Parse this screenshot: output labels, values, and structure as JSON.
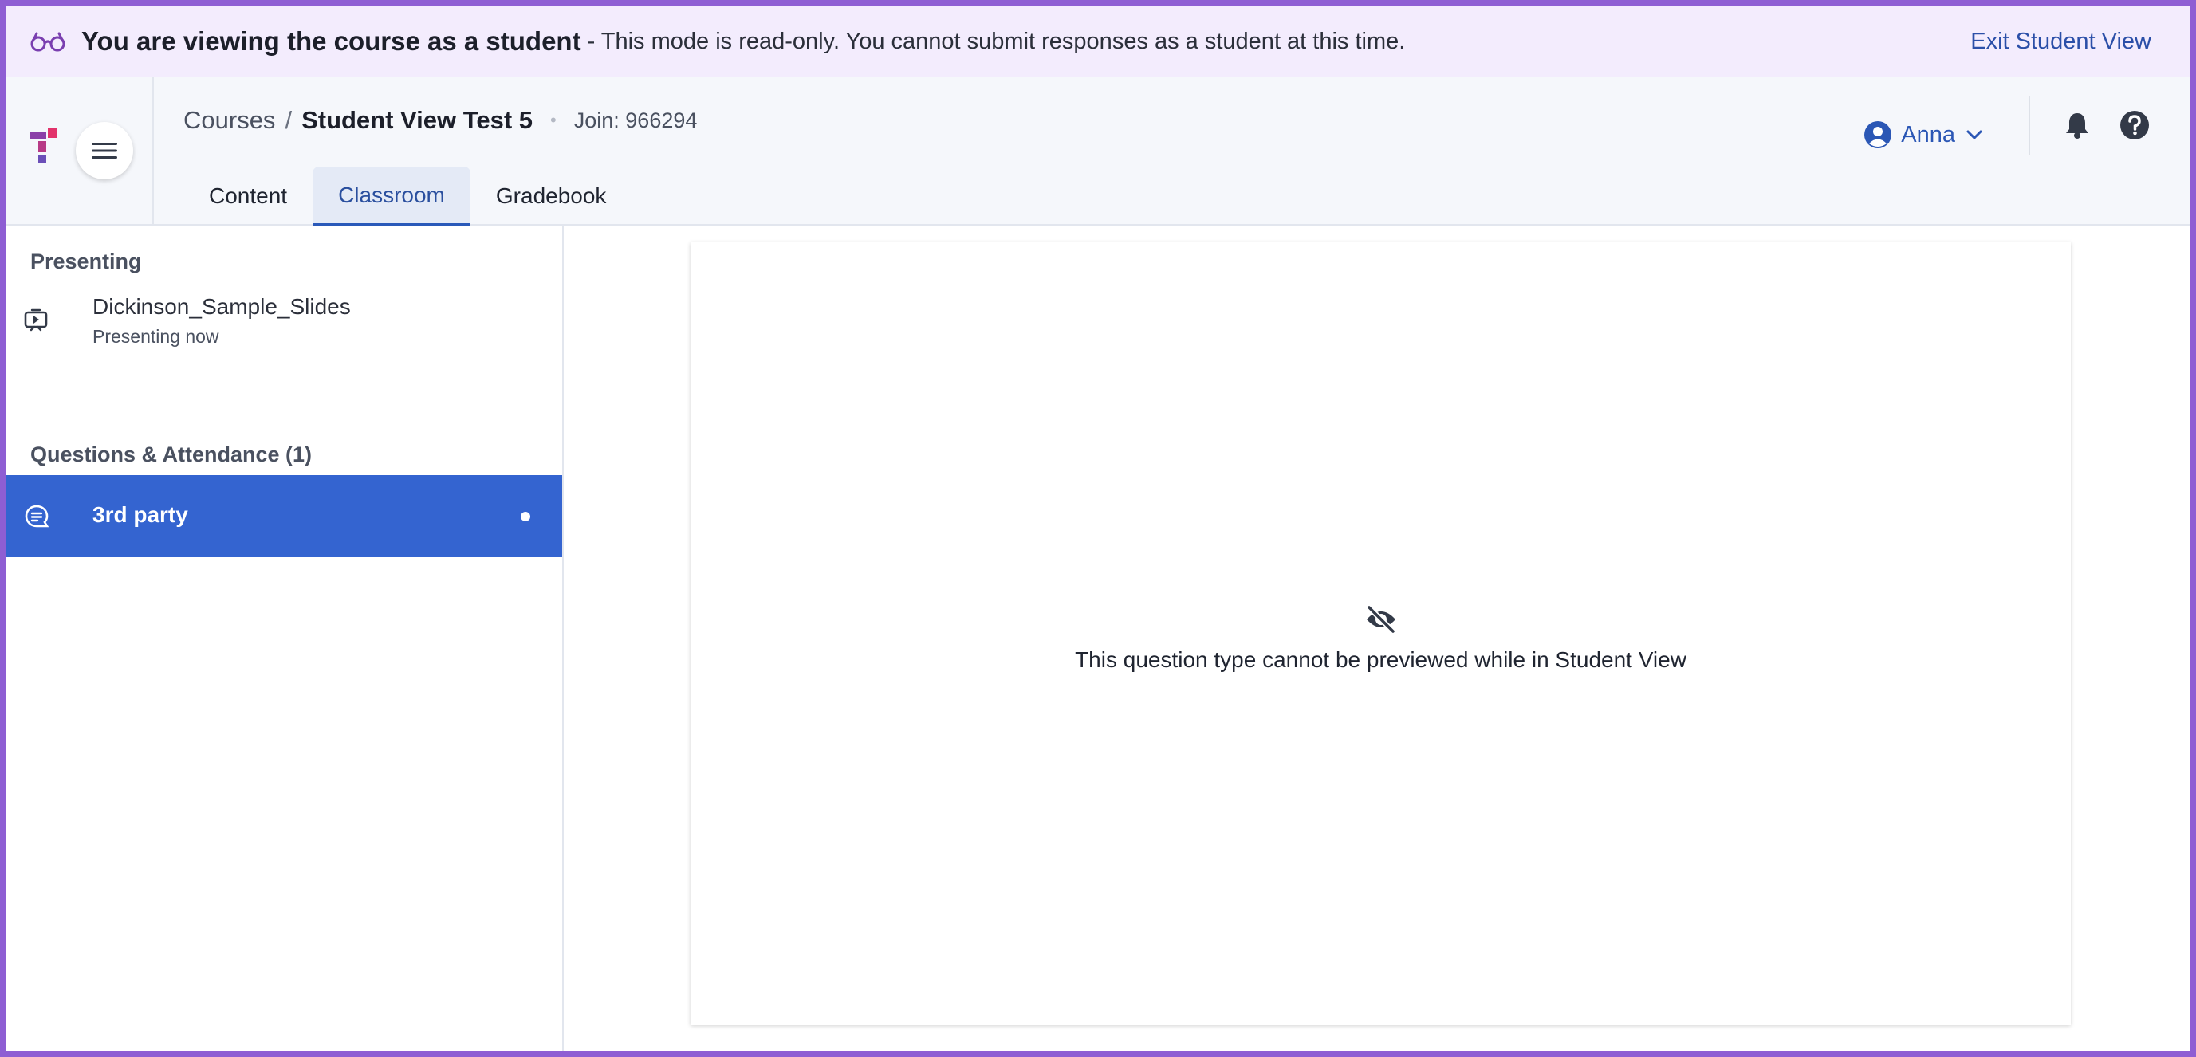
{
  "banner": {
    "strong": "You are viewing the course as a student",
    "rest": "- This mode is read-only. You cannot submit responses as a student at this time.",
    "exit_label": "Exit Student View",
    "icon": "glasses-icon"
  },
  "header": {
    "breadcrumb": {
      "courses": "Courses",
      "separator": "/",
      "course": "Student View Test 5",
      "dot": "•",
      "join": "Join: 966294"
    },
    "tabs": [
      {
        "label": "Content",
        "active": false
      },
      {
        "label": "Classroom",
        "active": true
      },
      {
        "label": "Gradebook",
        "active": false
      }
    ],
    "user": {
      "name": "Anna"
    }
  },
  "sidebar": {
    "presenting_title": "Presenting",
    "presenting_item": {
      "title": "Dickinson_Sample_Slides",
      "subtitle": "Presenting now",
      "icon": "presentation-icon"
    },
    "questions_title": "Questions & Attendance (1)",
    "question_item": {
      "label": "3rd party",
      "icon": "question-bubble-icon"
    }
  },
  "main": {
    "message": "This question type cannot be previewed while in Student View",
    "icon": "eye-off-icon"
  },
  "colors": {
    "accent": "#3464d0",
    "banner_bg": "#f3ecfd",
    "frame": "#8e5ed3",
    "link": "#2b4fa8"
  }
}
